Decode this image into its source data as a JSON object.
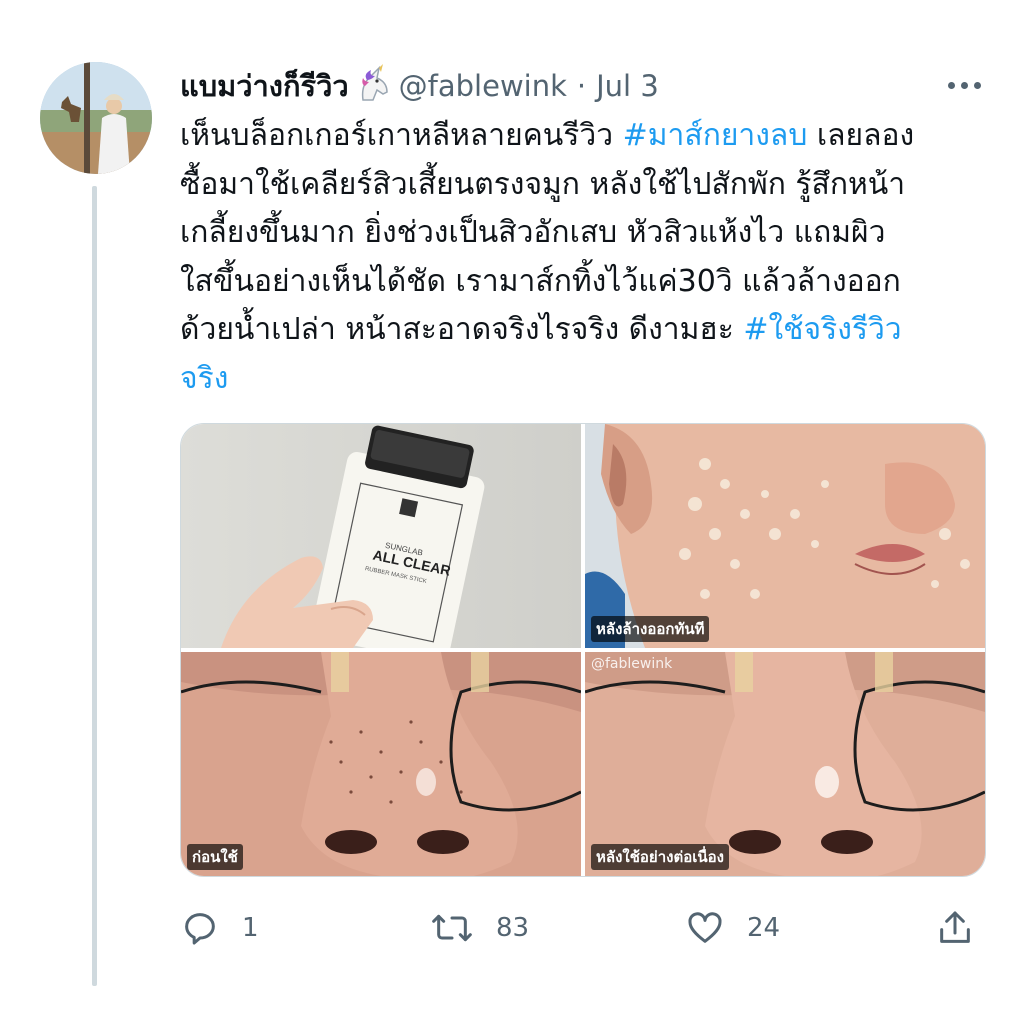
{
  "tweet": {
    "display_name": "แบมว่างก็รีวิว",
    "name_emoji": "🦄",
    "handle": "@fablewink",
    "separator": "·",
    "date": "Jul 3",
    "text_lines": [
      [
        {
          "t": "เห็นบล็อกเกอร์เกาหลีหลายคนรีวิว "
        },
        {
          "t": "#มาส์กยางลบ",
          "tag": true
        },
        {
          "t": " เลยลอง"
        }
      ],
      [
        {
          "t": "ซื้อมาใช้เคลียร์สิวเสี้ยนตรงจมูก หลังใช้ไปสักพัก รู้สึกหน้า"
        }
      ],
      [
        {
          "t": "เกลี้ยงขึ้นมาก ยิ่งช่วงเป็นสิวอักเสบ หัวสิวแห้งไว แถมผิว"
        }
      ],
      [
        {
          "t": "ใสขึ้นอย่างเห็นได้ชัด เรามาส์กทิ้งไว้แค่30วิ แล้วล้างออก"
        }
      ],
      [
        {
          "t": "ด้วยน้ำเปล่า หน้าสะอาดจริงไรจริง ดีงามฮะ "
        },
        {
          "t": "#ใช้จริงรีวิว",
          "tag": true
        }
      ],
      [
        {
          "t": "จริง",
          "tag": true
        }
      ]
    ],
    "hashtag_color": "#1d9bf0"
  },
  "media": {
    "product": {
      "brand": "SUNGLAB",
      "name": "ALL CLEAR",
      "subtitle": "RUBBER MASK STICK"
    },
    "captions": {
      "after_rinse": "หลังล้างออกทันที",
      "before": "ก่อนใช้",
      "after_continuous": "หลังใช้อย่างต่อเนื่อง"
    },
    "watermark": "@fablewink"
  },
  "actions": {
    "replies": "1",
    "retweets": "83",
    "likes": "24"
  },
  "colors": {
    "text": "#0f1419",
    "secondary": "#536471",
    "accent": "#1d9bf0",
    "border": "#cfd9de"
  }
}
